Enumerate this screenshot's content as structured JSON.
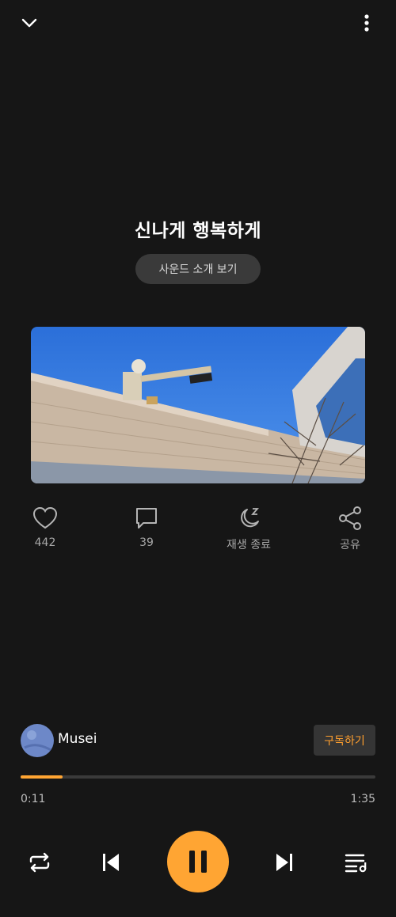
{
  "header": {
    "collapse_icon": "chevron-down-icon",
    "menu_icon": "more-vert-icon"
  },
  "track": {
    "title": "신나게 행복하게",
    "intro_button_label": "사운드 소개 보기"
  },
  "actions": [
    {
      "icon": "heart-icon",
      "label": "442"
    },
    {
      "icon": "comment-icon",
      "label": "39"
    },
    {
      "icon": "sleep-timer-icon",
      "label": "재생 종료"
    },
    {
      "icon": "share-icon",
      "label": "공유"
    }
  ],
  "artist": {
    "name": "Musei",
    "subscribe_label": "구독하기"
  },
  "playback": {
    "elapsed": "0:11",
    "duration": "1:35",
    "progress_fraction": 0.118,
    "accent_color": "#ffa533"
  },
  "controls": [
    "repeat-icon",
    "previous-icon",
    "pause-icon",
    "next-icon",
    "playlist-icon"
  ]
}
